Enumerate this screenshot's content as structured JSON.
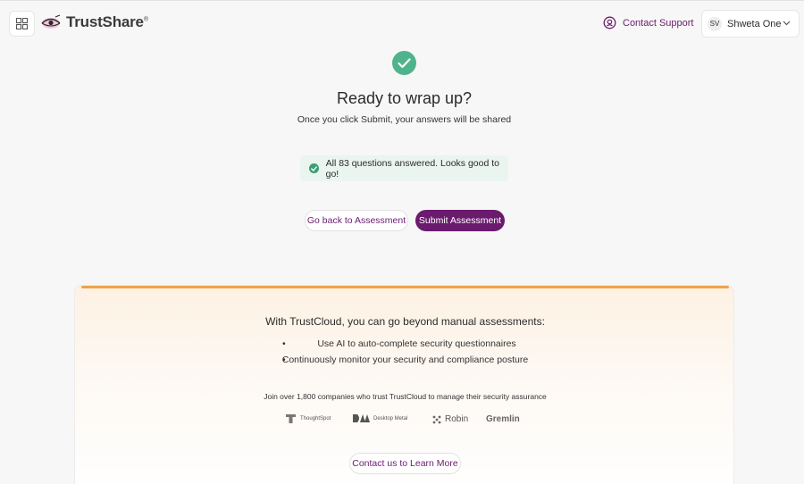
{
  "header": {
    "logo_text": "TrustShare",
    "logo_mark": "®",
    "contact_support": "Contact Support",
    "user_initials": "SV",
    "user_name": "Shweta One"
  },
  "main": {
    "title": "Ready to wrap up?",
    "subtitle": "Once you click Submit, your answers will be shared",
    "status_message": "All 83 questions answered. Looks good to go!",
    "back_button": "Go back to Assessment",
    "submit_button": "Submit Assessment"
  },
  "promo": {
    "title": "With TrustCloud, you can go beyond manual assessments:",
    "bullets": [
      "Use AI to auto-complete security questionnaires",
      "Continuously monitor your security and compliance posture"
    ],
    "join_text": "Join over 1,800 companies who trust TrustCloud to manage their security assurance",
    "companies": [
      "ThoughtSpot",
      "Desktop Metal",
      "Robin",
      "Gremlin"
    ],
    "learn_more_button": "Contact us to Learn More"
  },
  "icons": {
    "apps": "grid-icon",
    "logo": "eye-logo-icon",
    "support": "support-icon",
    "dropdown": "chevron-down-icon",
    "success": "check-circle-icon"
  },
  "colors": {
    "brand_purple": "#6a1b6e",
    "success_green": "#4fb38c",
    "accent_orange": "#f0a248"
  }
}
